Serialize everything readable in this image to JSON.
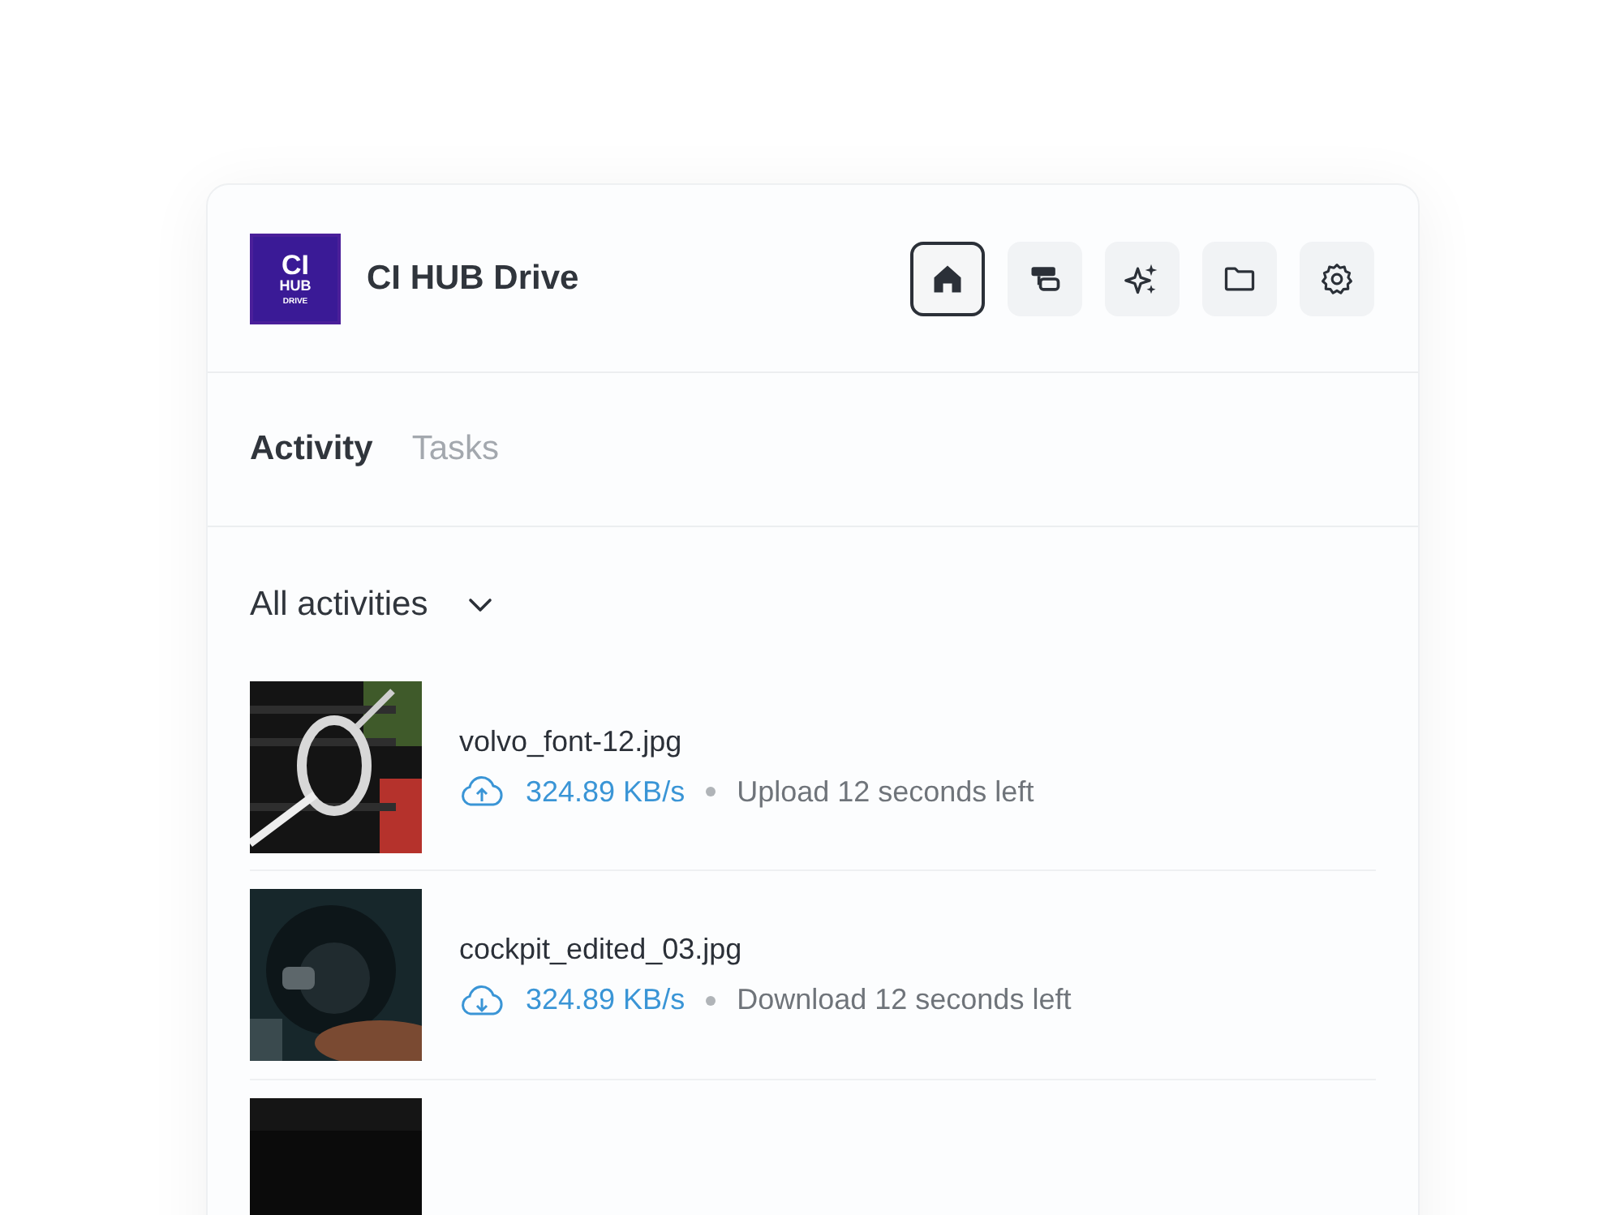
{
  "app": {
    "logo": {
      "top": "CI",
      "middle": "HUB",
      "bottom": "DRIVE"
    },
    "title": "CI HUB Drive"
  },
  "toolbar": [
    {
      "selected": true
    },
    {
      "selected": false
    },
    {
      "selected": false
    },
    {
      "selected": false
    },
    {
      "selected": false
    }
  ],
  "tabs": [
    {
      "label": "Activity",
      "selected": true
    },
    {
      "label": "Tasks",
      "selected": false
    }
  ],
  "filter": {
    "label": "All activities"
  },
  "activities": [
    {
      "thumbnail": {
        "kind": "picture"
      },
      "name": "volvo_font-12.jpg",
      "kind": "upload",
      "speed": "324.89 KB/s",
      "status": "Upload 12 seconds left"
    },
    {
      "thumbnail": {
        "kind": "picture"
      },
      "name": "cockpit_edited_03.jpg",
      "kind": "download",
      "speed": "324.89 KB/s",
      "status": "Download 12 seconds left"
    },
    {
      "thumbnail": {
        "kind": "picture"
      }
    }
  ]
}
